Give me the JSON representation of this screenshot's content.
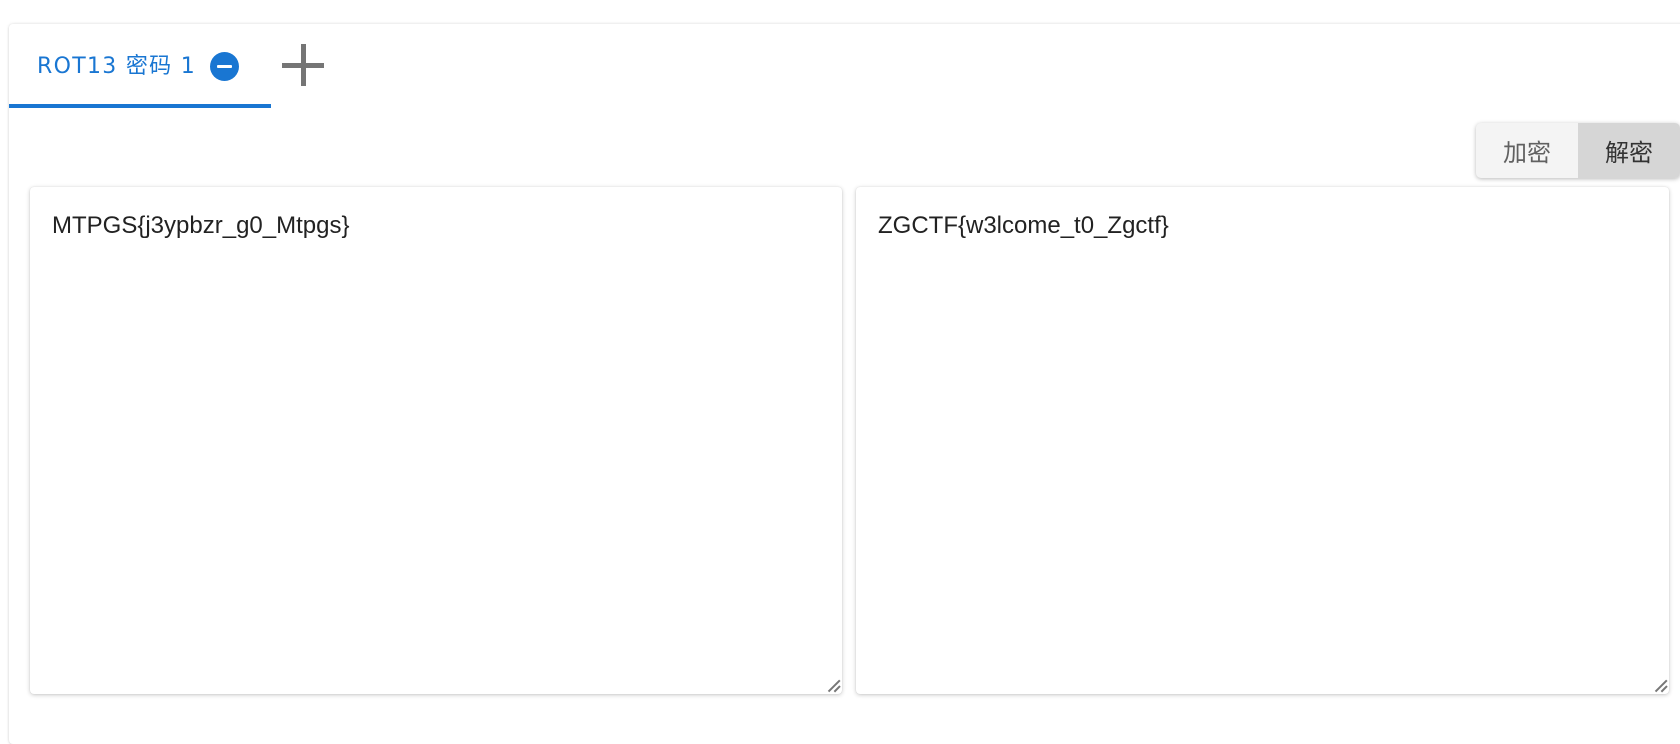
{
  "tabs": [
    {
      "label": "ROT13 密码 1",
      "active": true
    }
  ],
  "mode_toggle": {
    "encrypt_label": "加密",
    "decrypt_label": "解密",
    "selected": "解密"
  },
  "input_panel": {
    "value": "MTPGS{j3ypbzr_g0_Mtpgs}"
  },
  "output_panel": {
    "value": "ZGCTF{w3lcome_t0_Zgctf}"
  },
  "colors": {
    "accent": "#1976d2",
    "toggle_active_bg": "#d6d6d6",
    "toggle_bg": "#f4f4f4"
  },
  "icons": {
    "tab_close": "minus-circle-icon",
    "add_tab": "plus-icon"
  }
}
